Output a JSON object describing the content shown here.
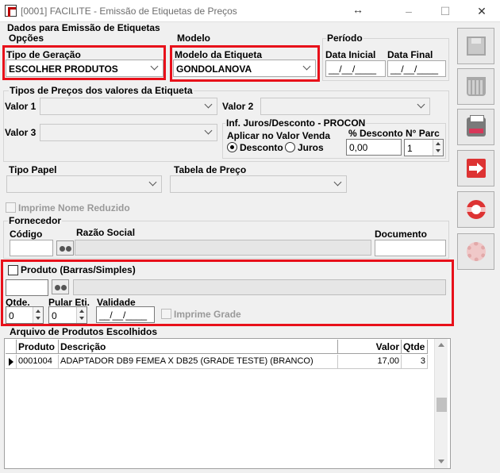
{
  "window": {
    "title": "[0001] FACILITE - Emissão de Etiquetas de Preços",
    "resize_glyph": "↔",
    "minimize_glyph": "–",
    "maximize_glyph": "☐",
    "close_glyph": "✕"
  },
  "dados_group": {
    "title": "Dados para Emissão de Etiquetas",
    "opcoes": {
      "title": "Opções",
      "tipo_geracao_label": "Tipo de Geração",
      "tipo_geracao_value": "ESCOLHER PRODUTOS"
    },
    "modelo": {
      "title": "Modelo",
      "modelo_label": "Modelo da Etiqueta",
      "modelo_value": "GONDOLANOVA"
    },
    "periodo": {
      "title": "Período",
      "inicial_label": "Data Inicial",
      "inicial_value": "__/__/____",
      "final_label": "Data Final",
      "final_value": "__/__/____"
    }
  },
  "precos_group": {
    "title": "Tipos de Preços dos valores da Etiqueta",
    "valor1_label": "Valor 1",
    "valor2_label": "Valor 2",
    "valor3_label": "Valor 3",
    "valor1_value": "",
    "valor2_value": "",
    "valor3_value": ""
  },
  "juros_group": {
    "title": "Inf. Juros/Desconto - PROCON",
    "aplicar_label": "Aplicar no Valor Venda",
    "radio_desconto": "Desconto",
    "radio_juros": "Juros",
    "selected": "Desconto",
    "pct_label": "% Desconto",
    "pct_value": "0,00",
    "parc_label": "N° Parc",
    "parc_value": "1"
  },
  "papel": {
    "tipo_papel_label": "Tipo Papel",
    "tipo_papel_value": "",
    "tabela_label": "Tabela de Preço",
    "tabela_value": "",
    "imprime_nome_label": "Imprime Nome Reduzido"
  },
  "fornecedor": {
    "title": "Fornecedor",
    "codigo_label": "Código",
    "codigo_value": "",
    "razao_label": "Razão Social",
    "razao_value": "",
    "documento_label": "Documento",
    "documento_value": ""
  },
  "produto": {
    "checkbox_label": "Produto (Barras/Simples)",
    "code_value": "",
    "desc_value": "",
    "qtde_label": "Qtde.",
    "qtde_value": "0",
    "pular_label": "Pular Eti.",
    "pular_value": "0",
    "validade_label": "Validade",
    "validade_value": "__/__/____",
    "imprime_grade_label": "Imprime Grade"
  },
  "arquivo": {
    "title": "Arquivo de Produtos Escolhidos",
    "columns": [
      "Produto",
      "Descrição",
      "Valor",
      "Qtde"
    ],
    "rows": [
      {
        "produto": "0001004",
        "descricao": "ADAPTADOR DB9 FEMEA X DB25 (GRADE TESTE) (BRANCO)",
        "valor": "17,00",
        "qtde": "3"
      }
    ]
  },
  "sidebar": {
    "buttons": [
      {
        "name": "save",
        "icon": "save-icon",
        "enabled": false
      },
      {
        "name": "delete",
        "icon": "trash-icon",
        "enabled": false
      },
      {
        "name": "print",
        "icon": "printer-icon",
        "enabled": true
      },
      {
        "name": "exit",
        "icon": "exit-door-icon",
        "enabled": true
      },
      {
        "name": "help",
        "icon": "lifebuoy-icon",
        "enabled": true
      },
      {
        "name": "settings",
        "icon": "gear-icon",
        "enabled": false
      }
    ]
  },
  "colors": {
    "highlight_red": "#e8101a",
    "window_bg": "#f0f0f0"
  }
}
